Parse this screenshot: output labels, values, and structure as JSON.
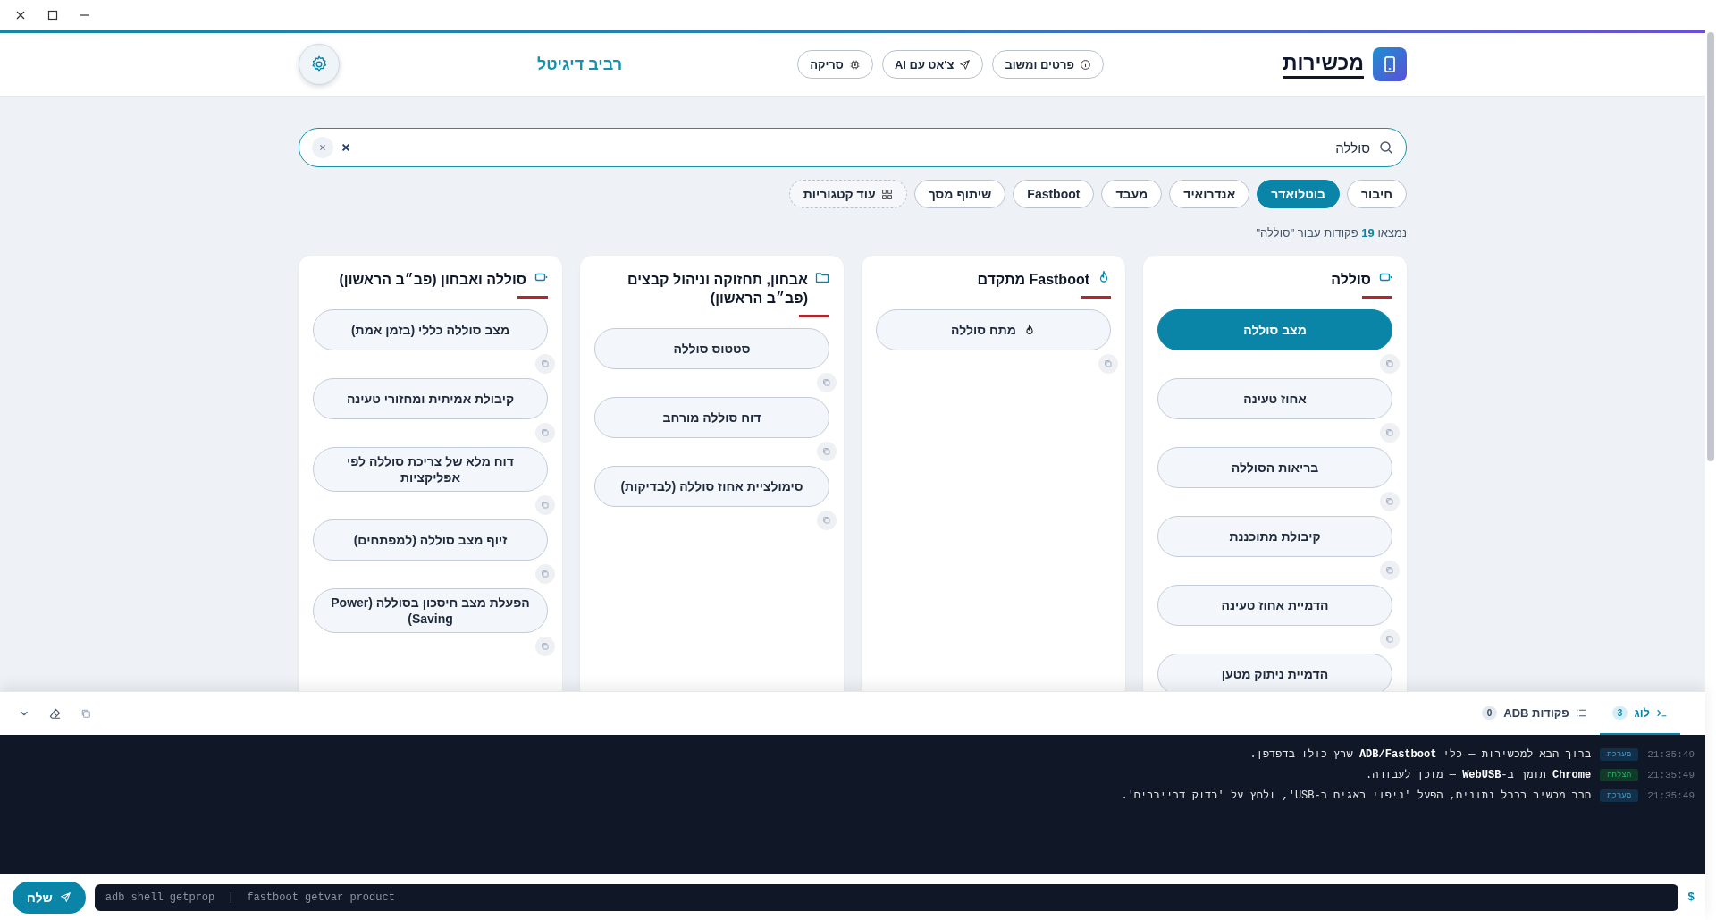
{
  "header": {
    "logo": "מכשירות",
    "nav": [
      {
        "label": "פרטים ומשוב",
        "kind": "info"
      },
      {
        "label": "צ'אט עם AI",
        "kind": "chat"
      },
      {
        "label": "סריקה",
        "kind": "scan"
      }
    ],
    "brand": "רביב דיגיטל"
  },
  "search": {
    "value": "סוללה"
  },
  "categories": [
    {
      "label": "חיבור",
      "selected": false
    },
    {
      "label": "בוטלואדר",
      "selected": true
    },
    {
      "label": "אנדרואיד",
      "selected": false
    },
    {
      "label": "מעבד",
      "selected": false
    },
    {
      "label": "Fastboot",
      "selected": false
    },
    {
      "label": "שיתוף מסך",
      "selected": false
    }
  ],
  "more_categories": {
    "label": "עוד קטגוריות"
  },
  "result_count": "נמצאו **19** פקודות עבור \"סוללה\"",
  "groups": [
    {
      "title": "סוללה",
      "kind": "battery",
      "commands": [
        {
          "label": "מצב סוללה",
          "selected": true
        },
        {
          "label": "אחוז טעינה",
          "selected": false
        },
        {
          "label": "בריאות הסוללה",
          "selected": false
        },
        {
          "label": "קיבולת מתוכננת",
          "selected": false
        },
        {
          "label": "הדמיית אחוז טעינה",
          "selected": false
        },
        {
          "label": "הדמיית ניתוק מטען",
          "selected": false
        }
      ]
    },
    {
      "title": "Fastboot מתקדם",
      "kind": "fastboot",
      "commands": [
        {
          "label": "מתח סוללה",
          "selected": false
        }
      ]
    },
    {
      "title": "אבחון, תחזוקה וניהול קבצים (פב״ב הראשון)",
      "kind": "files",
      "commands": [
        {
          "label": "סטטוס סוללה",
          "selected": false
        },
        {
          "label": "דוח סוללה מורחב",
          "selected": false
        },
        {
          "label": "סימולציית אחוז סוללה (לבדיקות)",
          "selected": false
        }
      ]
    },
    {
      "title": "סוללה ואבחון (פב״ב הראשון)",
      "kind": "battery",
      "commands": [
        {
          "label": "מצב סוללה כללי (בזמן אמת)",
          "selected": false
        },
        {
          "label": "קיבולת אמיתית ומחזורי טעינה",
          "selected": false
        },
        {
          "label": "דוח מלא של צריכת סוללה לפי אפליקציות",
          "selected": false
        },
        {
          "label": "זיוף מצב סוללה (למפתחים)",
          "selected": false
        },
        {
          "label": "הפעלת מצב חיסכון בסוללה (Power Saving)",
          "selected": false
        }
      ]
    }
  ],
  "console": {
    "tabs": [
      {
        "label": "לוג",
        "count": "3",
        "kind": "log",
        "selected": true
      },
      {
        "label": "פקודות ADB",
        "count": "0",
        "kind": "commands",
        "selected": false
      }
    ],
    "log": [
      {
        "time": "21:35:49",
        "tag": "מערכת",
        "kind": "system",
        "text": "ברוך הבא למכשירות — כלי **ADB/Fastboot** שרץ כולו בדפדפן."
      },
      {
        "time": "21:35:49",
        "tag": "הצלחה",
        "kind": "success",
        "text": "**Chrome** תומך ב-**WebUSB** — מוכן לעבודה."
      },
      {
        "time": "21:35:49",
        "tag": "מערכת",
        "kind": "system",
        "text": "חבר מכשיר בכבל נתונים, הפעל 'ניפוי באגים ב-USB', ולחץ על 'בדוק דרייברים'."
      }
    ],
    "prompt": "$",
    "input": {
      "placeholder": "adb shell getprop  |  fastboot getvar product"
    },
    "send": "שלח"
  }
}
